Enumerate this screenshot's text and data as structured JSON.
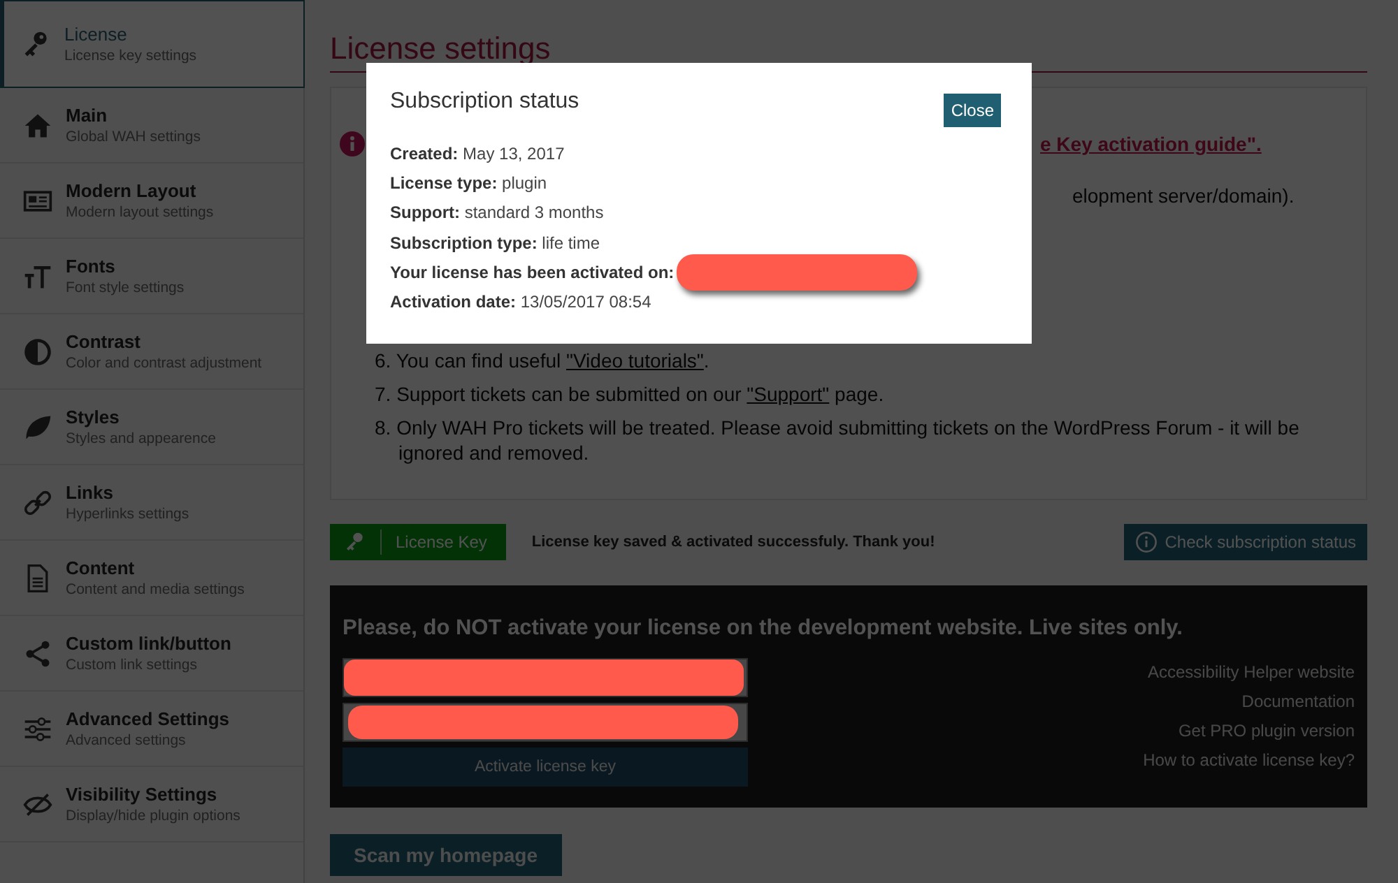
{
  "sidebar": {
    "items": [
      {
        "kind": "key",
        "title": "License",
        "subtitle": "License key settings",
        "selected": true
      },
      {
        "kind": "home",
        "title": "Main",
        "subtitle": "Global WAH settings",
        "selected": false
      },
      {
        "kind": "layout",
        "title": "Modern Layout",
        "subtitle": "Modern layout settings",
        "selected": false
      },
      {
        "kind": "fonts",
        "title": "Fonts",
        "subtitle": "Font style settings",
        "selected": false
      },
      {
        "kind": "contrast",
        "title": "Contrast",
        "subtitle": "Color and contrast adjustment",
        "selected": false
      },
      {
        "kind": "leaf",
        "title": "Styles",
        "subtitle": "Styles and appearence",
        "selected": false
      },
      {
        "kind": "link",
        "title": "Links",
        "subtitle": "Hyperlinks settings",
        "selected": false
      },
      {
        "kind": "document",
        "title": "Content",
        "subtitle": "Content and media settings",
        "selected": false
      },
      {
        "kind": "share",
        "title": "Custom link/button",
        "subtitle": "Custom link settings",
        "selected": false
      },
      {
        "kind": "sliders",
        "title": "Advanced Settings",
        "subtitle": "Advanced settings",
        "selected": false
      },
      {
        "kind": "eye-off",
        "title": "Visibility Settings",
        "subtitle": "Display/hide plugin options",
        "selected": false
      }
    ]
  },
  "main": {
    "title": "License settings",
    "info_fragment": "e Key activation guide\".",
    "hidden_line_fragment": "elopment server/domain).",
    "list_items": [
      {
        "number": "6.",
        "segments": [
          {
            "text": "You can find useful "
          },
          {
            "text": "\"Video tutorials\"",
            "link": true
          },
          {
            "text": "."
          }
        ]
      },
      {
        "number": "7.",
        "segments": [
          {
            "text": "Support tickets can be submitted on our "
          },
          {
            "text": "\"Support\"",
            "link": true
          },
          {
            "text": " page."
          }
        ]
      },
      {
        "number": "8.",
        "segments": [
          {
            "text": "Only WAH Pro tickets will be treated. Please avoid submitting tickets on the WordPress Forum - it will be ignored and removed."
          }
        ]
      }
    ],
    "key_button": "License Key",
    "key_message": "License key saved & activated successfuly. Thank you!",
    "check_button": "Check subscription status",
    "activation": {
      "warning": "Please, do NOT activate your license on the development website. Live sites only.",
      "activate_button": "Activate license key",
      "links": [
        "Accessibility Helper website",
        "Documentation",
        "Get PRO plugin version",
        "How to activate license key?"
      ]
    },
    "scan_button": "Scan my homepage"
  },
  "modal": {
    "title": "Subscription status",
    "close_button": "Close",
    "rows": [
      {
        "label": "Created:",
        "value": "May 13, 2017"
      },
      {
        "label": "License type:",
        "value": "plugin"
      },
      {
        "label": "Support:",
        "value": "standard 3 months"
      },
      {
        "label": "Subscription type:",
        "value": "life time"
      },
      {
        "label": "Your license has been activated on:",
        "redacted": true
      },
      {
        "label": "Activation date:",
        "value": "13/05/2017 08:54"
      }
    ]
  }
}
